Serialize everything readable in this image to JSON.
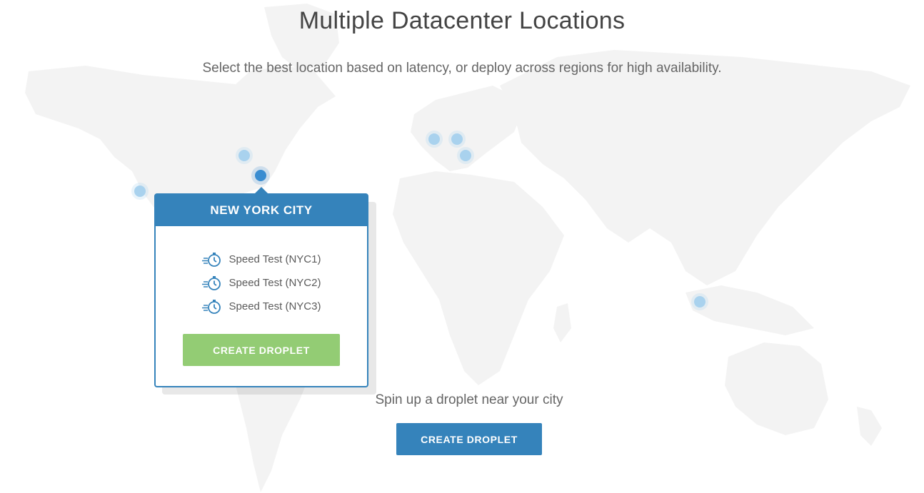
{
  "header": {
    "title": "Multiple Datacenter Locations",
    "subtitle": "Select the best location based on latency, or deploy across regions for high availability."
  },
  "popup": {
    "city": "NEW YORK CITY",
    "speed_tests": [
      {
        "label": "Speed Test (NYC1)",
        "icon": "stopwatch-icon"
      },
      {
        "label": "Speed Test (NYC2)",
        "icon": "stopwatch-icon"
      },
      {
        "label": "Speed Test (NYC3)",
        "icon": "stopwatch-icon"
      }
    ],
    "create_button": "CREATE DROPLET"
  },
  "cta": {
    "text": "Spin up a droplet near your city",
    "button": "CREATE DROPLET"
  },
  "colors": {
    "primary_blue": "#3583bb",
    "active_marker": "#3a8dd1",
    "inactive_marker": "#a9d2ee",
    "green_button": "#93cc74",
    "map_land": "#f3f3f3"
  }
}
